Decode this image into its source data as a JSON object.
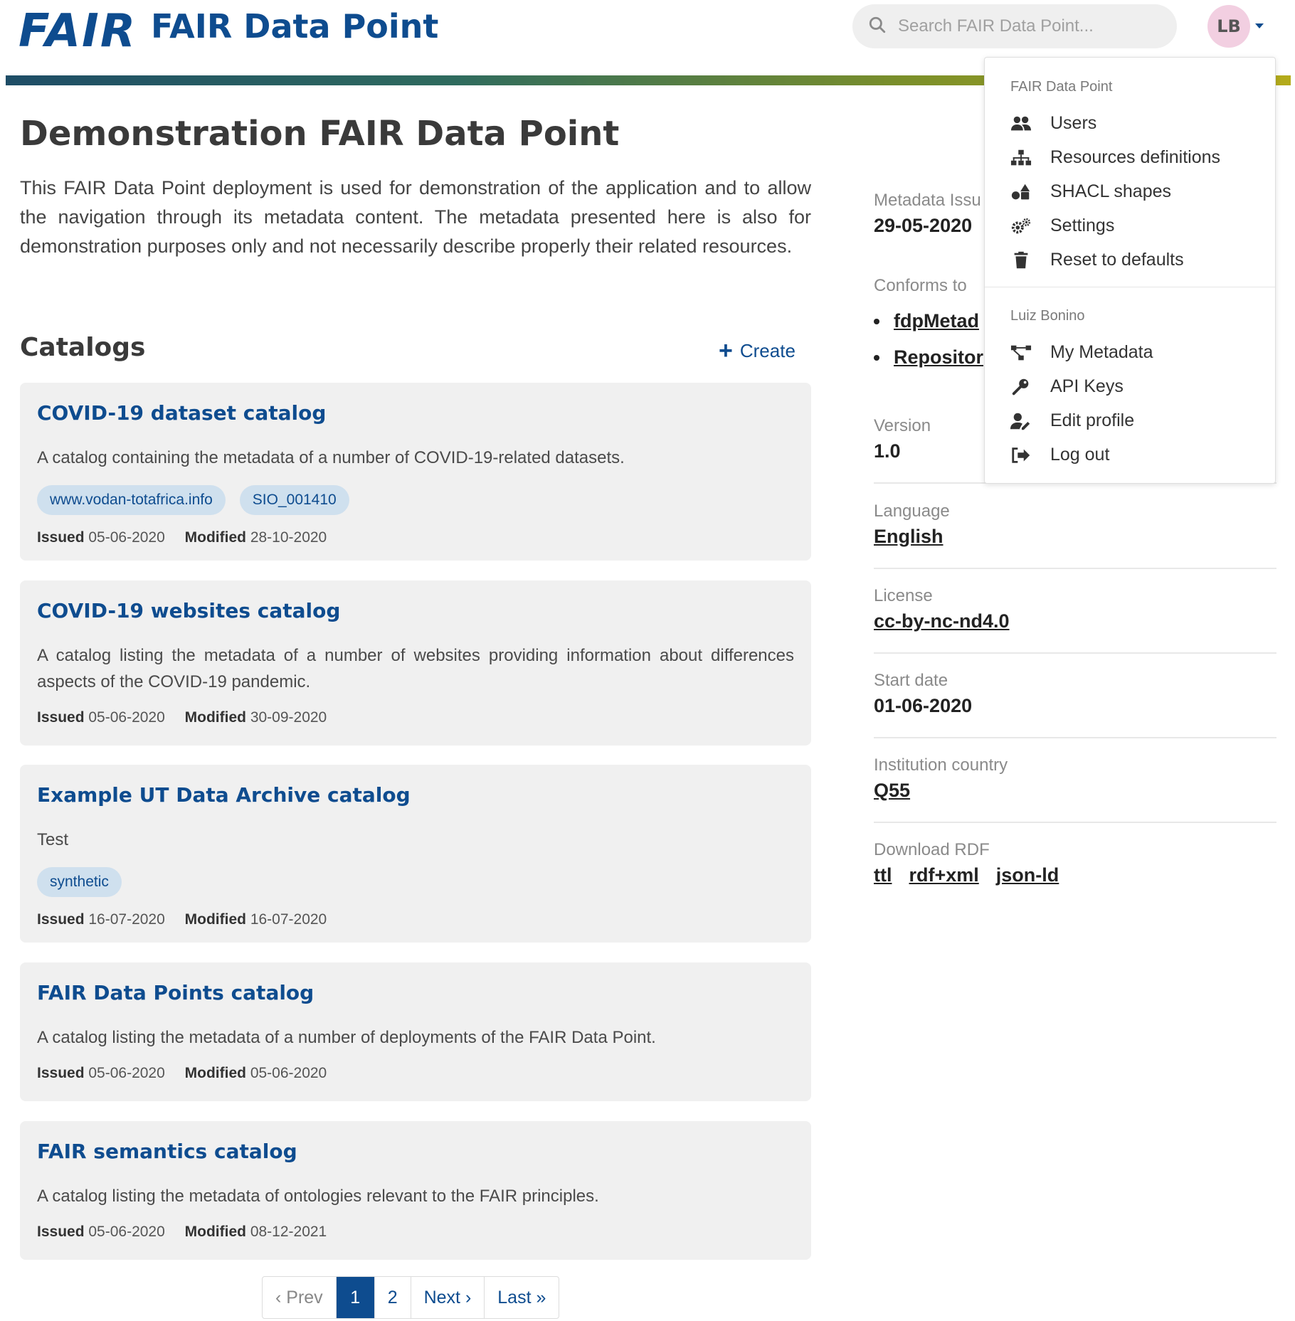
{
  "header": {
    "logo": "FAIR",
    "title": "FAIR Data Point",
    "search_placeholder": "Search FAIR Data Point...",
    "avatar_initials": "LB"
  },
  "page": {
    "title": "Demonstration FAIR Data Point",
    "description": "This FAIR Data Point deployment is used for demonstration of the application and to allow the navigation through its metadata content. The metadata presented here is also for demonstration purposes only and not necessarily describe properly their related resources."
  },
  "catalogs": {
    "title": "Catalogs",
    "create_label": "Create",
    "issued_label": "Issued",
    "modified_label": "Modified",
    "items": [
      {
        "title": "COVID-19 dataset catalog",
        "description": "A catalog containing the metadata of a number of COVID-19-related datasets.",
        "tags": [
          "www.vodan-totafrica.info",
          "SIO_001410"
        ],
        "issued": "05-06-2020",
        "modified": "28-10-2020"
      },
      {
        "title": "COVID-19 websites catalog",
        "description": "A catalog listing the metadata of a number of websites providing information about differences aspects of the COVID-19 pandemic.",
        "tags": [],
        "issued": "05-06-2020",
        "modified": "30-09-2020"
      },
      {
        "title": "Example UT Data Archive catalog",
        "description": "Test",
        "tags": [
          "synthetic"
        ],
        "issued": "16-07-2020",
        "modified": "16-07-2020"
      },
      {
        "title": "FAIR Data Points catalog",
        "description": "A catalog listing the metadata of a number of deployments of the FAIR Data Point.",
        "tags": [],
        "issued": "05-06-2020",
        "modified": "05-06-2020"
      },
      {
        "title": "FAIR semantics catalog",
        "description": "A catalog listing the metadata of ontologies relevant to the FAIR principles.",
        "tags": [],
        "issued": "05-06-2020",
        "modified": "08-12-2021"
      }
    ]
  },
  "pagination": {
    "prev": "Prev",
    "pages": [
      "1",
      "2"
    ],
    "current": "1",
    "next": "Next",
    "last": "Last"
  },
  "metadata": {
    "issued_label": "Metadata Issu",
    "issued_value": "29-05-2020",
    "conforms_label": "Conforms to",
    "conforms_items": [
      "fdpMetad",
      "Repositor"
    ],
    "version_label": "Version",
    "version_value": "1.0",
    "language_label": "Language",
    "language_value": "English",
    "license_label": "License",
    "license_value": "cc-by-nc-nd4.0",
    "start_date_label": "Start date",
    "start_date_value": "01-06-2020",
    "country_label": "Institution country",
    "country_value": "Q55",
    "rdf_label": "Download RDF",
    "rdf_formats": [
      "ttl",
      "rdf+xml",
      "json-ld"
    ]
  },
  "dropdown": {
    "section1_header": "FAIR Data Point",
    "section1_items": [
      {
        "label": "Users",
        "icon": "users-icon"
      },
      {
        "label": "Resources definitions",
        "icon": "sitemap-icon"
      },
      {
        "label": "SHACL shapes",
        "icon": "shapes-icon"
      },
      {
        "label": "Settings",
        "icon": "cogs-icon"
      },
      {
        "label": "Reset to defaults",
        "icon": "trash-icon"
      }
    ],
    "section2_header": "Luiz Bonino",
    "section2_items": [
      {
        "label": "My Metadata",
        "icon": "project-diagram-icon"
      },
      {
        "label": "API Keys",
        "icon": "key-icon"
      },
      {
        "label": "Edit profile",
        "icon": "user-edit-icon"
      },
      {
        "label": "Log out",
        "icon": "sign-out-icon"
      }
    ]
  },
  "colors": {
    "brand": "#0e4c8f",
    "card_bg": "#f0f0f0",
    "tag_bg": "#cfe0ee",
    "avatar_bg": "#f2cfe1"
  }
}
